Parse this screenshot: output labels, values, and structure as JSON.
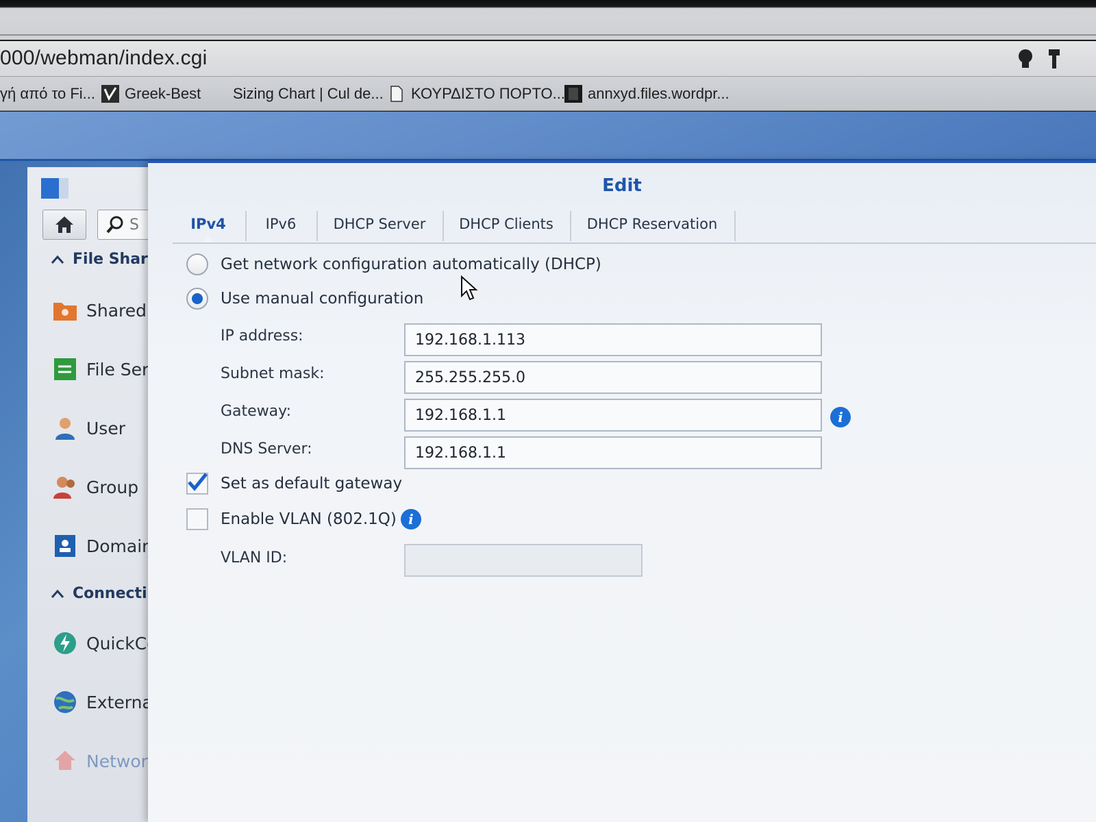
{
  "browser": {
    "url": "000/webman/index.cgi",
    "bookmarks": [
      {
        "label": "γή από το Fi...",
        "icon": "none"
      },
      {
        "label": "Greek-Best",
        "icon": "site-logo-icon"
      },
      {
        "label": "Sizing Chart | Cul de...",
        "icon": "none"
      },
      {
        "label": "ΚΟΥΡΔΙΣΤΟ ΠΟΡΤΟ...",
        "icon": "document-icon"
      },
      {
        "label": "annxyd.files.wordpr...",
        "icon": "site-logo-icon"
      }
    ]
  },
  "sidebar": {
    "search_placeholder": "S",
    "sections": [
      {
        "label": "File Shar",
        "items": [
          {
            "label": "Shared",
            "icon": "shared-folder-icon"
          },
          {
            "label": "File Ser",
            "icon": "file-services-icon"
          },
          {
            "label": "User",
            "icon": "user-icon"
          },
          {
            "label": "Group",
            "icon": "group-icon"
          },
          {
            "label": "Domain",
            "icon": "domain-icon"
          }
        ]
      },
      {
        "label": "Connecti",
        "items": [
          {
            "label": "QuickCo",
            "icon": "quickconnect-icon"
          },
          {
            "label": "Externa",
            "icon": "external-access-icon"
          },
          {
            "label": "Networ",
            "icon": "network-icon"
          }
        ]
      }
    ]
  },
  "dialog": {
    "title": "Edit",
    "tabs": [
      "IPv4",
      "IPv6",
      "DHCP Server",
      "DHCP Clients",
      "DHCP Reservation"
    ],
    "active_tab": "IPv4",
    "options": {
      "dhcp_label": "Get network configuration automatically (DHCP)",
      "manual_label": "Use manual configuration",
      "selected": "manual"
    },
    "fields": {
      "ip_label": "IP address:",
      "ip_value": "192.168.1.113",
      "subnet_label": "Subnet mask:",
      "subnet_value": "255.255.255.0",
      "gateway_label": "Gateway:",
      "gateway_value": "192.168.1.1",
      "dns_label": "DNS Server:",
      "dns_value": "192.168.1.1",
      "vlan_id_label": "VLAN ID:",
      "vlan_id_value": ""
    },
    "checkboxes": {
      "default_gateway_label": "Set as default gateway",
      "default_gateway_checked": true,
      "vlan_label": "Enable VLAN (802.1Q)",
      "vlan_checked": false
    },
    "info_glyph": "i"
  },
  "colors": {
    "accent": "#1f52a6",
    "title_bar_line": "#2257b3",
    "info_icon": "#1c6fd6",
    "radio_selected": "#1a63c9"
  }
}
